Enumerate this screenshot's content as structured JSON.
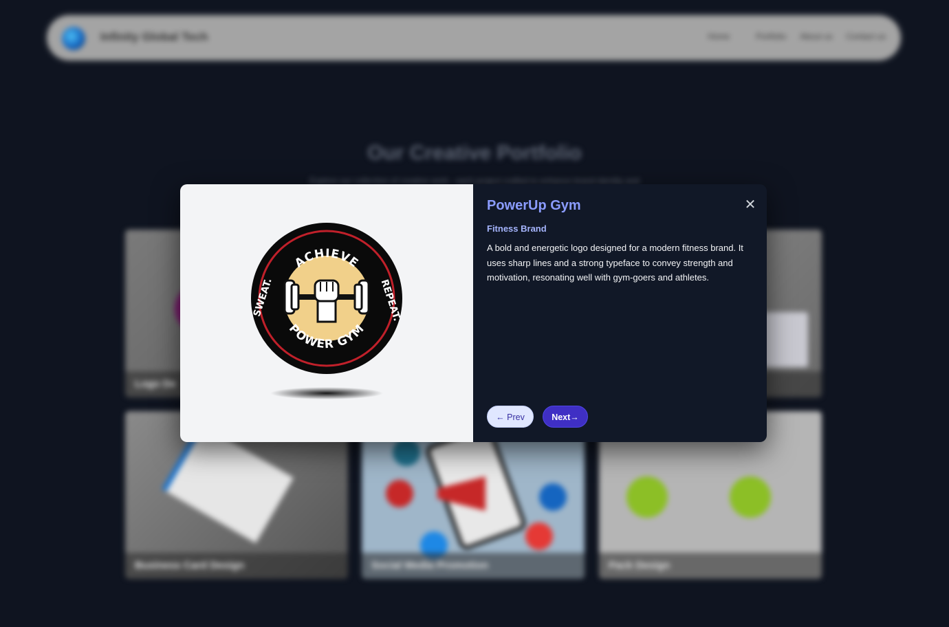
{
  "site": {
    "brand": "Infinity Global Tech",
    "nav": [
      "Home",
      "Portfolio",
      "About us",
      "Contact us"
    ]
  },
  "portfolio": {
    "title": "Our Creative Portfolio",
    "subtitle": "Explore our collection of creative work - each project crafted to enhance brand identity and",
    "cards": [
      "Logo De",
      "",
      "",
      "Business Card Design",
      "Social Media Promotion",
      "Pack Design"
    ]
  },
  "modal": {
    "title": "PowerUp Gym",
    "category": "Fitness Brand",
    "description": "A bold and energetic logo designed for a modern fitness brand. It uses sharp lines and a strong typeface to convey strength and motivation, resonating well with gym-goers and athletes.",
    "close": "✕",
    "prev_label": "← Prev",
    "next_label": "Next→",
    "logo": {
      "top_text": "ACHIEVE",
      "right_text": "REPEAT.",
      "left_text": "SWEAT.",
      "bottom_text": "POWER GYM",
      "colors": {
        "ring": "#0a0a0a",
        "accent_ring": "#c0202a",
        "center": "#f1d08a"
      }
    }
  },
  "colors": {
    "page_bg": "#0f1420",
    "modal_bg": "#111827",
    "title": "#8b9cff",
    "category": "#a5b4fc",
    "next_button": "#3f2fc4",
    "prev_button": "#e0e7ff"
  }
}
